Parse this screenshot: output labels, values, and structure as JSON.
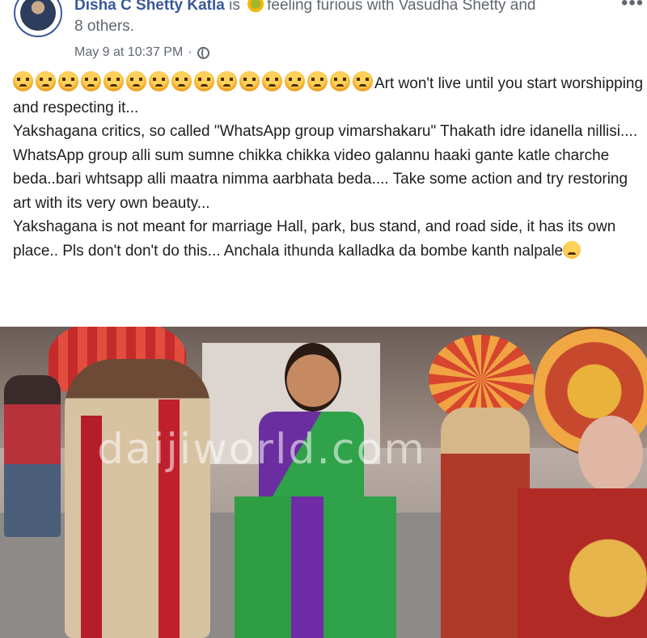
{
  "post": {
    "author": "Disha C Shetty Katla",
    "is_word": "is",
    "feeling": "feeling furious with Vasudha Shetty and",
    "others": "8 others.",
    "timestamp": "May 9 at 10:37 PM",
    "separator": "·",
    "privacy_icon": "globe-icon",
    "more_icon": "more-options-icon",
    "feeling_icon": "furious-emoji"
  },
  "body": {
    "angry_emoji_count": 16,
    "line1": "Art won't live until you start worshipping and respecting it...",
    "line2": "Yakshagana critics, so called \"WhatsApp group vimarshakaru\" Thakath idre idanella nillisi....",
    "line3": "WhatsApp group alli sum sumne chikka chikka video galannu haaki gante katle charche beda..bari whtsapp alli maatra nimma aarbhata beda.... Take some action and try restoring art with its very own beauty...",
    "line4": "Yakshagana is not meant for marriage Hall, park, bus stand, and road side, it has its own place.. Pls don't don't do this... Anchala ithunda kalladka da bombe kanth nalpale",
    "end_emoji": "sad-face-emoji"
  },
  "photo": {
    "watermark": "daijiworld.com"
  },
  "colors": {
    "link": "#385898",
    "meta": "#606770",
    "text": "#1c1e21"
  }
}
